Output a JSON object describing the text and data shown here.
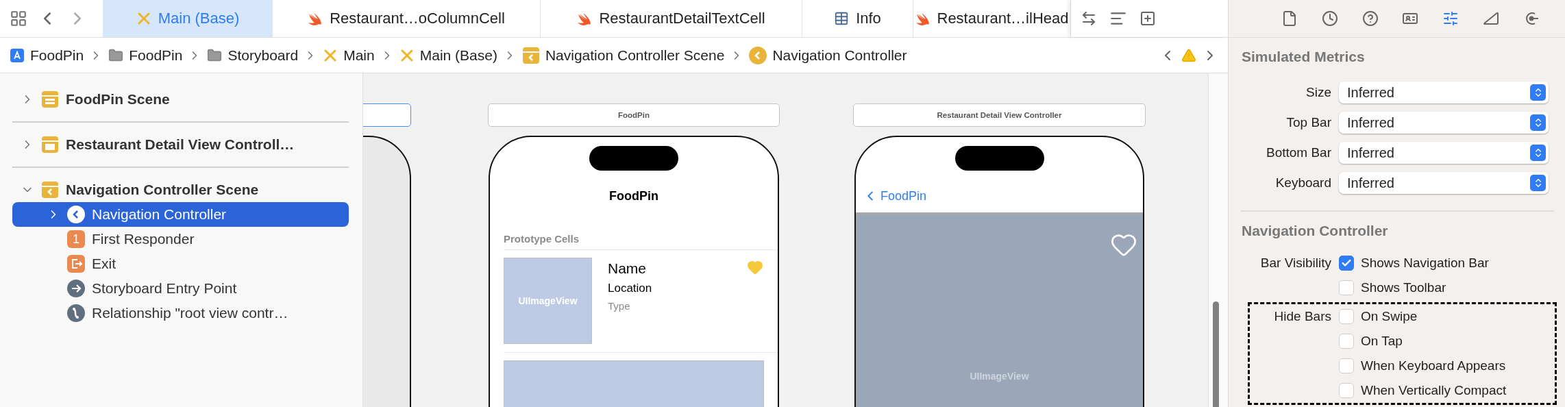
{
  "editor_tabs": [
    {
      "label": "Main (Base)",
      "kind": "storyboard",
      "selected": true
    },
    {
      "label": "Restaurant…oColumnCell",
      "kind": "swift",
      "selected": false
    },
    {
      "label": "RestaurantDetailTextCell",
      "kind": "swift",
      "selected": false
    },
    {
      "label": "Info",
      "kind": "plist",
      "selected": false
    },
    {
      "label": "Restaurant…ilHead",
      "kind": "swift",
      "selected": false
    }
  ],
  "breadcrumbs": [
    {
      "label": "FoodPin",
      "kind": "project"
    },
    {
      "label": "FoodPin",
      "kind": "folder"
    },
    {
      "label": "Storyboard",
      "kind": "folder"
    },
    {
      "label": "Main",
      "kind": "storyboard"
    },
    {
      "label": "Main (Base)",
      "kind": "storyboard"
    },
    {
      "label": "Navigation Controller Scene",
      "kind": "scene"
    },
    {
      "label": "Navigation Controller",
      "kind": "navigation"
    }
  ],
  "outline": [
    {
      "label": "FoodPin Scene",
      "kind": "table-scene",
      "expanded": false,
      "selected": false
    },
    {
      "label": "Restaurant Detail View Controll…",
      "kind": "scene",
      "expanded": false,
      "selected": false
    },
    {
      "label": "Navigation Controller Scene",
      "kind": "nav-scene",
      "expanded": true,
      "selected": false,
      "children": [
        {
          "label": "Navigation Controller",
          "kind": "navigation",
          "expanded": false,
          "selected": true
        },
        {
          "label": "First Responder",
          "kind": "responder",
          "badge": "1",
          "selected": false
        },
        {
          "label": "Exit",
          "kind": "exit",
          "selected": false
        },
        {
          "label": "Storyboard Entry Point",
          "kind": "entry",
          "selected": false
        },
        {
          "label": "Relationship \"root view contr…",
          "kind": "relationship",
          "selected": false
        }
      ]
    }
  ],
  "canvas": {
    "scenes": [
      {
        "kind": "partial",
        "selected": true
      },
      {
        "kind": "table",
        "title": "FoodPin",
        "selected": false,
        "nav_title": "FoodPin",
        "section_header": "Prototype Cells",
        "cell": {
          "image_label": "UIImageView",
          "name": "Name",
          "location": "Location",
          "type": "Type",
          "favorite": true
        }
      },
      {
        "kind": "detail",
        "title": "Restaurant Detail View Controller",
        "selected": false,
        "back_label": "FoodPin",
        "image_label": "UIImageView",
        "favorite": false
      }
    ]
  },
  "inspector": {
    "tabs": [
      {
        "kind": "file",
        "selected": false
      },
      {
        "kind": "history",
        "selected": false
      },
      {
        "kind": "help",
        "selected": false
      },
      {
        "kind": "identity",
        "selected": false
      },
      {
        "kind": "attributes",
        "selected": true
      },
      {
        "kind": "size",
        "selected": false
      },
      {
        "kind": "connections",
        "selected": false
      }
    ],
    "simulated_metrics": {
      "title": "Simulated Metrics",
      "fields": [
        {
          "label": "Size",
          "value": "Inferred"
        },
        {
          "label": "Top Bar",
          "value": "Inferred"
        },
        {
          "label": "Bottom Bar",
          "value": "Inferred"
        },
        {
          "label": "Keyboard",
          "value": "Inferred"
        }
      ]
    },
    "navigation_controller": {
      "title": "Navigation Controller",
      "groups": [
        {
          "label": "Bar Visibility",
          "highlighted": false,
          "options": [
            {
              "label": "Shows Navigation Bar",
              "checked": true
            },
            {
              "label": "Shows Toolbar",
              "checked": false
            }
          ]
        },
        {
          "label": "Hide Bars",
          "highlighted": true,
          "options": [
            {
              "label": "On Swipe",
              "checked": false
            },
            {
              "label": "On Tap",
              "checked": false
            },
            {
              "label": "When Keyboard Appears",
              "checked": false
            },
            {
              "label": "When Vertically Compact",
              "checked": false
            }
          ]
        }
      ]
    }
  }
}
